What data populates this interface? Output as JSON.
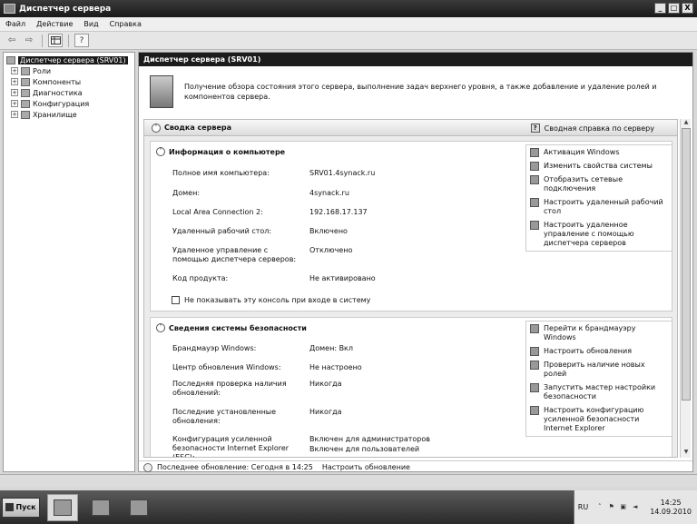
{
  "window": {
    "title": "Диспетчер сервера",
    "minimize": "_",
    "maximize": "□",
    "close": "X"
  },
  "menu": [
    "Файл",
    "Действие",
    "Вид",
    "Справка"
  ],
  "toolbar": {
    "back": "⇦",
    "forward": "⇨",
    "help": "?"
  },
  "tree": {
    "root": "Диспетчер сервера (SRV01)",
    "children": [
      "Роли",
      "Компоненты",
      "Диагностика",
      "Конфигурация",
      "Хранилище"
    ],
    "expander": "+"
  },
  "pane": {
    "header": "Диспетчер сервера (SRV01)",
    "intro": "Получение обзора состояния этого сервера, выполнение задач верхнего уровня, а также добавление и удаление ролей и компонентов сервера."
  },
  "summary": {
    "title": "Сводка сервера",
    "help_link": "Сводная справка по серверу",
    "collapse": "˄"
  },
  "computer_info": {
    "title": "Информация о компьютере",
    "fields": [
      {
        "label": "Полное имя компьютера:",
        "value": "SRV01.4synack.ru"
      },
      {
        "label": "Домен:",
        "value": "4synack.ru"
      },
      {
        "label": "Local Area Connection 2:",
        "value": "192.168.17.137"
      },
      {
        "label": "Удаленный рабочий стол:",
        "value": "Включено"
      },
      {
        "label": "Удаленное управление с помощью диспетчера серверов:",
        "value": "Отключено"
      },
      {
        "label": "Код продукта:",
        "value": "Не активировано"
      }
    ],
    "checkbox_label": "Не показывать эту консоль при входе в систему",
    "tasks": [
      "Активация Windows",
      "Изменить свойства системы",
      "Отобразить сетевые подключения",
      "Настроить удаленный рабочий стол",
      "Настроить удаленное управление с помощью диспетчера серверов"
    ]
  },
  "security_info": {
    "title": "Сведения системы безопасности",
    "fields": [
      {
        "label": "Брандмауэр Windows:",
        "value": "Домен: Вкл"
      },
      {
        "label": "Центр обновления Windows:",
        "value": "Не настроено"
      },
      {
        "label": "Последняя проверка наличия обновлений:",
        "value": "Никогда"
      },
      {
        "label": "Последние установленные обновления:",
        "value": "Никогда"
      },
      {
        "label": "Конфигурация усиленной безопасности Internet Explorer (ESC):",
        "value": "Включен для администраторов",
        "value2": "Включен для пользователей"
      }
    ],
    "tasks": [
      "Перейти к брандмауэру Windows",
      "Настроить обновления",
      "Проверить наличие новых ролей",
      "Запустить мастер настройки безопасности",
      "Настроить конфигурацию усиленной безопасности Internet Explorer"
    ]
  },
  "status": {
    "last_update": "Последнее обновление: Сегодня в 14:25",
    "configure_link": "Настроить обновление"
  },
  "taskbar": {
    "start": "Пуск",
    "lang": "RU",
    "tray_arrow": "˄",
    "time": "14:25",
    "date": "14.09.2010"
  }
}
